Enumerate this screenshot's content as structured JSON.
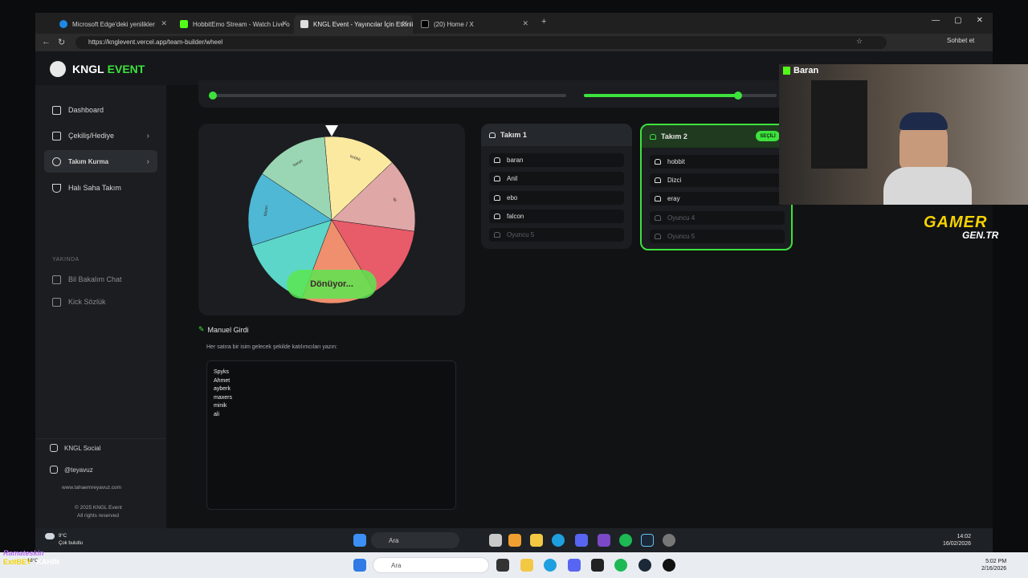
{
  "browser": {
    "tabs": [
      {
        "title": "Microsoft Edge'deki yenilikler",
        "icon_color": "#1e88e5"
      },
      {
        "title": "HobbitEmo Stream - Watch Live o",
        "icon_color": "#53fc18"
      },
      {
        "title": "KNGL Event - Yayıncılar İçin Etkinli",
        "icon_color": "#dddddd",
        "active": true
      },
      {
        "title": "(20) Home / X",
        "icon_color": "#111111"
      }
    ],
    "url": "https://knglevent.vercel.app/team-builder/wheel",
    "copilot_label": "Sohbet et"
  },
  "app": {
    "brand": {
      "name_a": "KNGL",
      "name_b": "EVENT",
      "accent": "#3de23d"
    },
    "nav": [
      {
        "label": "Dashboard",
        "icon": "home-icon"
      },
      {
        "label": "Çekiliş/Hediye",
        "icon": "gift-icon"
      },
      {
        "label": "Takım Kurma",
        "icon": "users-icon",
        "active": true
      },
      {
        "label": "Halı Saha Takım",
        "icon": "trophy-icon"
      }
    ],
    "section_label": "YAKINDA",
    "soon_nav": [
      {
        "label": "Bil Bakalım Chat",
        "icon": "chat-icon"
      },
      {
        "label": "Kick Sözlük",
        "icon": "chat-icon"
      }
    ],
    "footer": {
      "social": "KNGL Social",
      "handle": "@teyavuz",
      "site": "www.tahaemreyavuz.com",
      "copyright": "© 2025 KNGL Event",
      "rights": "All rights reserved"
    },
    "sliders": {
      "first_value": 0.0,
      "second_value": 0.8
    },
    "wheel": {
      "spin_label": "Dönüyor...",
      "segments": [
        {
          "color": "#fbe9a0",
          "label": "hobbit"
        },
        {
          "color": "#e0a7a7",
          "label": "ali"
        },
        {
          "color": "#e85b68",
          "label": ""
        },
        {
          "color": "#f08f6e",
          "label": ""
        },
        {
          "color": "#5bd6c8",
          "label": ""
        },
        {
          "color": "#4fb8d4",
          "label": "falcon"
        },
        {
          "color": "#9ad6b4",
          "label": "baran"
        }
      ]
    },
    "teams": [
      {
        "name": "Takım 1",
        "players": [
          "baran",
          "Anil",
          "ebo",
          "falcon"
        ],
        "empty_slot": "Oyuncu 5"
      },
      {
        "name": "Takım 2",
        "badge": "SEÇİLİ",
        "players": [
          "hobbit",
          "Dizci",
          "eray"
        ],
        "empty_slots": [
          "Oyuncu 4",
          "Oyuncu 5"
        ]
      }
    ],
    "manual": {
      "title": "Manuel Girdi",
      "hint": "Her satıra bir isim gelecek şekilde katılımcıları yazın:",
      "entries": [
        "Spyks",
        "Ahmet",
        "ayberk",
        "maxers",
        "minik",
        "ali"
      ]
    }
  },
  "stream_overlay": {
    "streamer": "Baran",
    "brand_a": "GAMER",
    "brand_b": "GEN.TR",
    "chat_names": [
      "Ramateskin",
      "ExitBEY",
      "KAHİN"
    ]
  },
  "inner_taskbar": {
    "weather_temp": "9°C",
    "weather_desc": "Çok bulutlu",
    "search": "Ara",
    "time": "14:02",
    "date": "16/02/2026"
  },
  "outer_taskbar": {
    "weather_temp": "18°C",
    "search": "Ara",
    "time": "5:02 PM",
    "date": "2/16/2026"
  }
}
